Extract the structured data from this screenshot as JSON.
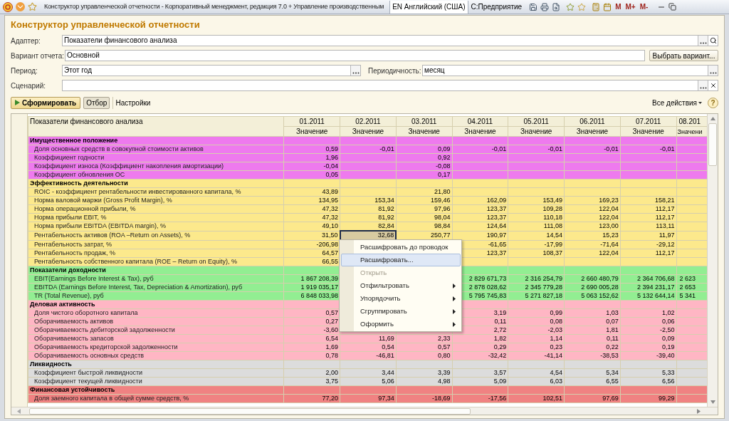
{
  "window": {
    "title": "Конструктор управленческой отчетности - Корпоративный менеджмент, редакция 7.0 + Управление производственным",
    "language": "EN Английский (США)",
    "app": "С:Предприятие",
    "memory_buttons": [
      "M",
      "M+",
      "M-"
    ]
  },
  "form": {
    "title": "Конструктор управленческой отчетности",
    "adapter": {
      "label": "Адаптер:",
      "value": "Показатели финансового анализа"
    },
    "variant": {
      "label": "Вариант отчета:",
      "value": "Основной",
      "button": "Выбрать вариант..."
    },
    "period": {
      "label": "Период:",
      "value": "Этот год"
    },
    "periodicity": {
      "label": "Периодичность:",
      "value": "месяц"
    },
    "scenario": {
      "label": "Сценарий:"
    }
  },
  "toolbar": {
    "generate": "Сформировать",
    "filter": {
      "label": "Отбор",
      "selected": true
    },
    "settings": "Настройки",
    "all_actions": "Все действия",
    "help": "?"
  },
  "table": {
    "title": "Показатели финансового анализа",
    "columns": [
      {
        "period": "01.2011",
        "sub": "Значение",
        "selected": false
      },
      {
        "period": "02.2011",
        "sub": "Значение",
        "selected": true
      },
      {
        "period": "03.2011",
        "sub": "Значение",
        "selected": false
      },
      {
        "period": "04.2011",
        "sub": "Значение",
        "selected": false
      },
      {
        "period": "05.2011",
        "sub": "Значение",
        "selected": false
      },
      {
        "period": "06.2011",
        "sub": "Значение",
        "selected": false
      },
      {
        "period": "07.2011",
        "sub": "Значение",
        "selected": false
      },
      {
        "period": "08.201",
        "sub": "Значени",
        "selected": false
      }
    ],
    "groups": [
      {
        "name": "Имущественное положение",
        "color": "#ee7aee",
        "rows": [
          {
            "name": "Доля основных средств в совокупной стоимости активов",
            "selected": false,
            "cells": [
              {
                "kind": "number",
                "text": "0,59"
              },
              {
                "kind": "number",
                "text": "-0,01"
              },
              {
                "kind": "number",
                "text": "0,09"
              },
              {
                "kind": "number",
                "text": "-0,01"
              },
              {
                "kind": "number",
                "text": "-0,01"
              },
              {
                "kind": "number",
                "text": "-0,01"
              },
              {
                "kind": "number",
                "text": "-0,01"
              }
            ]
          },
          {
            "name": "Коэффициент годности",
            "selected": false,
            "cells": [
              {
                "kind": "number",
                "text": "1,96"
              },
              {
                "kind": "empty"
              },
              {
                "kind": "number",
                "text": "0,92"
              }
            ]
          },
          {
            "name": "Коэффициент износа (Коэффициент накопления амортизации)",
            "selected": false,
            "cells": [
              {
                "kind": "number",
                "text": "-0,04"
              },
              {
                "kind": "empty"
              },
              {
                "kind": "number",
                "text": "-0,08"
              }
            ]
          },
          {
            "name": "Коэффициент обновления ОС",
            "selected": false,
            "cells": [
              {
                "kind": "number",
                "text": "0,05"
              },
              {
                "kind": "empty"
              },
              {
                "kind": "number",
                "text": "0,17"
              }
            ]
          }
        ]
      },
      {
        "name": "Эффективность деятельности",
        "color": "#fce98c",
        "rows": [
          {
            "name": "ROIC - коэффициент рентабельности инвестированного капитала, %",
            "selected": false,
            "cells": [
              {
                "kind": "number",
                "text": "43,89"
              },
              {
                "kind": "empty"
              },
              {
                "kind": "number",
                "text": "21,80"
              }
            ]
          },
          {
            "name": "Норма валовой маржи (Gross Profit Margin), %",
            "selected": false,
            "cells": [
              {
                "kind": "number",
                "text": "134,95"
              },
              {
                "kind": "number",
                "text": "153,34"
              },
              {
                "kind": "number",
                "text": "159,46"
              },
              {
                "kind": "number",
                "text": "162,09"
              },
              {
                "kind": "number",
                "text": "153,49"
              },
              {
                "kind": "number",
                "text": "169,23"
              },
              {
                "kind": "number",
                "text": "158,21"
              }
            ]
          },
          {
            "name": "Норма операционной прибыли, %",
            "selected": false,
            "cells": [
              {
                "kind": "number",
                "text": "47,32"
              },
              {
                "kind": "number",
                "text": "81,92"
              },
              {
                "kind": "number",
                "text": "97,96"
              },
              {
                "kind": "number",
                "text": "123,37"
              },
              {
                "kind": "number",
                "text": "109,28"
              },
              {
                "kind": "number",
                "text": "122,04"
              },
              {
                "kind": "number",
                "text": "112,17"
              }
            ]
          },
          {
            "name": "Норма прибыли EBIT, %",
            "selected": false,
            "cells": [
              {
                "kind": "number",
                "text": "47,32"
              },
              {
                "kind": "number",
                "text": "81,92"
              },
              {
                "kind": "number",
                "text": "98,04"
              },
              {
                "kind": "number",
                "text": "123,37"
              },
              {
                "kind": "number",
                "text": "110,18"
              },
              {
                "kind": "number",
                "text": "122,04"
              },
              {
                "kind": "number",
                "text": "112,17"
              }
            ]
          },
          {
            "name": "Норма прибыли EBITDA (EBITDA margin), %",
            "selected": false,
            "cells": [
              {
                "kind": "number",
                "text": "49,10"
              },
              {
                "kind": "number",
                "text": "82,84"
              },
              {
                "kind": "number",
                "text": "98,84"
              },
              {
                "kind": "number",
                "text": "124,64"
              },
              {
                "kind": "number",
                "text": "111,08"
              },
              {
                "kind": "number",
                "text": "123,00"
              },
              {
                "kind": "number",
                "text": "113,11"
              }
            ]
          },
          {
            "name": "Рентабельность активов (ROA –Return on Assets), %",
            "selected": true,
            "cells": [
              {
                "kind": "number",
                "text": "31,50"
              },
              {
                "kind": "number",
                "text": "32,68"
              },
              {
                "kind": "number",
                "text": "250,77"
              },
              {
                "kind": "number",
                "text": "190,97"
              },
              {
                "kind": "number",
                "text": "14,54"
              },
              {
                "kind": "number",
                "text": "15,23"
              },
              {
                "kind": "number",
                "text": "11,97"
              }
            ]
          },
          {
            "name": "Рентабельность затрат, %",
            "selected": false,
            "cells": [
              {
                "kind": "number",
                "text": "-206,98"
              },
              {
                "kind": "empty"
              },
              {
                "kind": "empty"
              },
              {
                "kind": "number",
                "text": "-61,65"
              },
              {
                "kind": "number",
                "text": "-17,99"
              },
              {
                "kind": "number",
                "text": "-71,64"
              },
              {
                "kind": "number",
                "text": "-29,12"
              }
            ]
          },
          {
            "name": "Рентабельность продаж, %",
            "selected": false,
            "cells": [
              {
                "kind": "number",
                "text": "64,57"
              },
              {
                "kind": "empty"
              },
              {
                "kind": "empty"
              },
              {
                "kind": "number",
                "text": "123,37"
              },
              {
                "kind": "number",
                "text": "108,37"
              },
              {
                "kind": "number",
                "text": "122,04"
              },
              {
                "kind": "number",
                "text": "112,17"
              }
            ]
          },
          {
            "name": "Рентабельность собственного капитала (ROE – Return on Equity), %",
            "selected": false,
            "cells": [
              {
                "kind": "number",
                "text": "66,55"
              }
            ]
          }
        ]
      },
      {
        "name": "Показатели доходности",
        "color": "#92ee92",
        "rows": [
          {
            "name": "EBIT(Earnings Before Interest & Tax), руб",
            "selected": false,
            "cells": [
              {
                "kind": "number",
                "text": "1 867 208,39"
              },
              {
                "kind": "empty"
              },
              {
                "kind": "empty"
              },
              {
                "kind": "number",
                "text": "2 829 671,73"
              },
              {
                "kind": "number",
                "text": "2 316 254,79"
              },
              {
                "kind": "number",
                "text": "2 660 480,79"
              },
              {
                "kind": "number",
                "text": "2 364 706,68"
              },
              {
                "kind": "number",
                "text": "2 623"
              }
            ]
          },
          {
            "name": "EBITDA (Earnings Before Interest, Tax, Depreciation & Amortization), руб",
            "selected": false,
            "cells": [
              {
                "kind": "number",
                "text": "1 919 035,17"
              },
              {
                "kind": "empty"
              },
              {
                "kind": "empty"
              },
              {
                "kind": "number",
                "text": "2 878 028,62"
              },
              {
                "kind": "number",
                "text": "2 345 779,28"
              },
              {
                "kind": "number",
                "text": "2 690 005,28"
              },
              {
                "kind": "number",
                "text": "2 394 231,17"
              },
              {
                "kind": "number",
                "text": "2 653"
              }
            ]
          },
          {
            "name": "TR (Total Revenue), руб",
            "selected": false,
            "cells": [
              {
                "kind": "number",
                "text": "6 848 033,98"
              },
              {
                "kind": "empty"
              },
              {
                "kind": "empty"
              },
              {
                "kind": "number",
                "text": "5 795 745,83"
              },
              {
                "kind": "number",
                "text": "5 271 827,18"
              },
              {
                "kind": "number",
                "text": "5 063 152,62"
              },
              {
                "kind": "number",
                "text": "5 132 644,14"
              },
              {
                "kind": "number",
                "text": "5 341"
              }
            ]
          }
        ]
      },
      {
        "name": "Деловая активность",
        "color": "#ffb6c4",
        "rows": [
          {
            "name": "Доля чистого оборотного капитала",
            "selected": false,
            "cells": [
              {
                "kind": "number",
                "text": "0,57"
              },
              {
                "kind": "empty"
              },
              {
                "kind": "empty"
              },
              {
                "kind": "number",
                "text": "3,19"
              },
              {
                "kind": "number",
                "text": "0,99"
              },
              {
                "kind": "number",
                "text": "1,03"
              },
              {
                "kind": "number",
                "text": "1,02"
              }
            ]
          },
          {
            "name": "Оборачиваемость активов",
            "selected": false,
            "cells": [
              {
                "kind": "number",
                "text": "0,27"
              },
              {
                "kind": "empty"
              },
              {
                "kind": "empty"
              },
              {
                "kind": "number",
                "text": "0,11"
              },
              {
                "kind": "number",
                "text": "0,08"
              },
              {
                "kind": "number",
                "text": "0,07"
              },
              {
                "kind": "number",
                "text": "0,06"
              }
            ]
          },
          {
            "name": "Оборачиваемость дебиторской задолженности",
            "selected": false,
            "cells": [
              {
                "kind": "number",
                "text": "-3,60"
              },
              {
                "kind": "empty"
              },
              {
                "kind": "empty"
              },
              {
                "kind": "number",
                "text": "2,72"
              },
              {
                "kind": "number",
                "text": "-2,03"
              },
              {
                "kind": "number",
                "text": "1,81"
              },
              {
                "kind": "number",
                "text": "-2,50"
              }
            ]
          },
          {
            "name": "Оборачиваемость запасов",
            "selected": false,
            "cells": [
              {
                "kind": "number",
                "text": "6,54"
              },
              {
                "kind": "number",
                "text": "11,69"
              },
              {
                "kind": "number",
                "text": "2,33"
              },
              {
                "kind": "number",
                "text": "1,82"
              },
              {
                "kind": "number",
                "text": "1,14"
              },
              {
                "kind": "number",
                "text": "0,11"
              },
              {
                "kind": "number",
                "text": "0,09"
              }
            ]
          },
          {
            "name": "Оборачиваемость кредиторской задолженности",
            "selected": false,
            "cells": [
              {
                "kind": "number",
                "text": "1,69"
              },
              {
                "kind": "number",
                "text": "0,54"
              },
              {
                "kind": "number",
                "text": "0,57"
              },
              {
                "kind": "number",
                "text": "0,29"
              },
              {
                "kind": "number",
                "text": "0,23"
              },
              {
                "kind": "number",
                "text": "0,22"
              },
              {
                "kind": "number",
                "text": "0,19"
              }
            ]
          },
          {
            "name": "Оборачиваемость основных средств",
            "selected": false,
            "cells": [
              {
                "kind": "number",
                "text": "0,78"
              },
              {
                "kind": "number",
                "text": "-46,81"
              },
              {
                "kind": "number",
                "text": "0,80"
              },
              {
                "kind": "number",
                "text": "-32,42"
              },
              {
                "kind": "number",
                "text": "-41,14"
              },
              {
                "kind": "number",
                "text": "-38,53"
              },
              {
                "kind": "number",
                "text": "-39,40"
              }
            ]
          }
        ]
      },
      {
        "name": "Ликвидность",
        "color": "#dcdcdc",
        "rows": [
          {
            "name": "Коэффициент быстрой ликвидности",
            "selected": false,
            "cells": [
              {
                "kind": "number",
                "text": "2,00"
              },
              {
                "kind": "number",
                "text": "3,44"
              },
              {
                "kind": "number",
                "text": "3,39"
              },
              {
                "kind": "number",
                "text": "3,57"
              },
              {
                "kind": "number",
                "text": "4,54"
              },
              {
                "kind": "number",
                "text": "5,34"
              },
              {
                "kind": "number",
                "text": "5,33"
              }
            ]
          },
          {
            "name": "Коэффициент текущей ликвидности",
            "selected": false,
            "cells": [
              {
                "kind": "number",
                "text": "3,75"
              },
              {
                "kind": "number",
                "text": "5,06"
              },
              {
                "kind": "number",
                "text": "4,98"
              },
              {
                "kind": "number",
                "text": "5,09"
              },
              {
                "kind": "number",
                "text": "6,03"
              },
              {
                "kind": "number",
                "text": "6,55"
              },
              {
                "kind": "number",
                "text": "6,56"
              }
            ]
          }
        ]
      },
      {
        "name": "Финансовая устойчивость",
        "color": "#f08282",
        "rows": [
          {
            "name": "Доля заемного капитала в общей сумме средств, %",
            "selected": false,
            "cells": [
              {
                "kind": "number",
                "text": "77,20"
              },
              {
                "kind": "number",
                "text": "97,34"
              },
              {
                "kind": "number",
                "text": "-18,69"
              },
              {
                "kind": "number",
                "text": "-17,56"
              },
              {
                "kind": "number",
                "text": "102,51"
              },
              {
                "kind": "number",
                "text": "97,69"
              },
              {
                "kind": "number",
                "text": "99,29"
              }
            ]
          }
        ]
      }
    ]
  },
  "context_menu": {
    "items": [
      {
        "label": "Расшифровать до проводок",
        "selected": false,
        "disabled": false,
        "submenu": false
      },
      {
        "label": "Расшифровать...",
        "selected": true,
        "disabled": false,
        "submenu": false
      },
      {
        "label": "Открыть",
        "selected": false,
        "disabled": true,
        "submenu": false
      },
      {
        "label": "Отфильтровать",
        "selected": false,
        "disabled": false,
        "submenu": true
      },
      {
        "label": "Упорядочить",
        "selected": false,
        "disabled": false,
        "submenu": true
      },
      {
        "label": "Сгруппировать",
        "selected": false,
        "disabled": false,
        "submenu": true
      },
      {
        "label": "Оформить",
        "selected": false,
        "disabled": false,
        "submenu": true
      }
    ]
  }
}
